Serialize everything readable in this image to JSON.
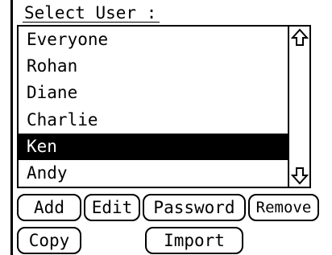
{
  "dialog": {
    "title": "Select User :"
  },
  "user_list": {
    "items": [
      "Everyone",
      "Rohan",
      "Diane",
      "Charlie",
      "Ken",
      "Andy"
    ],
    "selected_index": 4
  },
  "scrollbar": {
    "up_icon": "up-arrow-icon",
    "down_icon": "down-arrow-icon"
  },
  "buttons": {
    "add": "Add",
    "edit": "Edit",
    "password": "Password",
    "remove": "Remove",
    "copy": "Copy",
    "import": "Import"
  }
}
